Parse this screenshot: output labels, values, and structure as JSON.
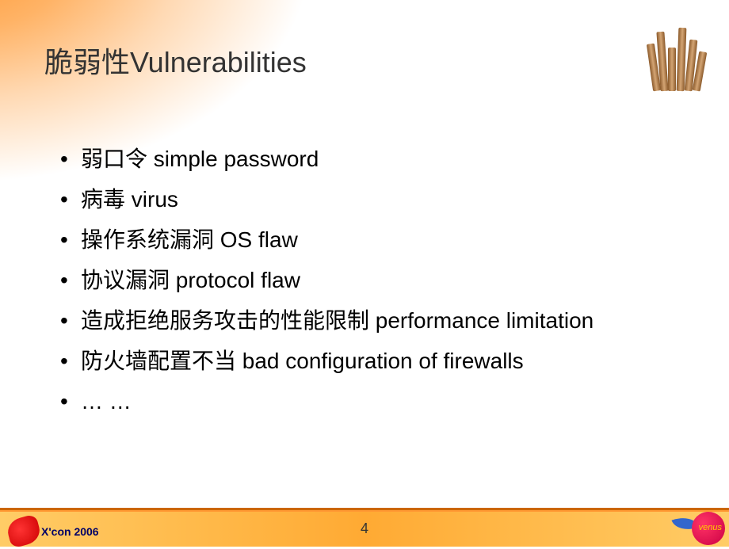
{
  "slide": {
    "title": "脆弱性Vulnerabilities",
    "bullets": [
      "弱口令 simple password",
      "病毒 virus",
      "操作系统漏洞 OS flaw",
      "协议漏洞 protocol flaw",
      "造成拒绝服务攻击的性能限制 performance limitation",
      "防火墙配置不当 bad configuration of firewalls",
      "… …"
    ],
    "page_number": "4"
  },
  "footer": {
    "left_logo_text": "X'con 2006",
    "right_logo_text": "venus"
  }
}
